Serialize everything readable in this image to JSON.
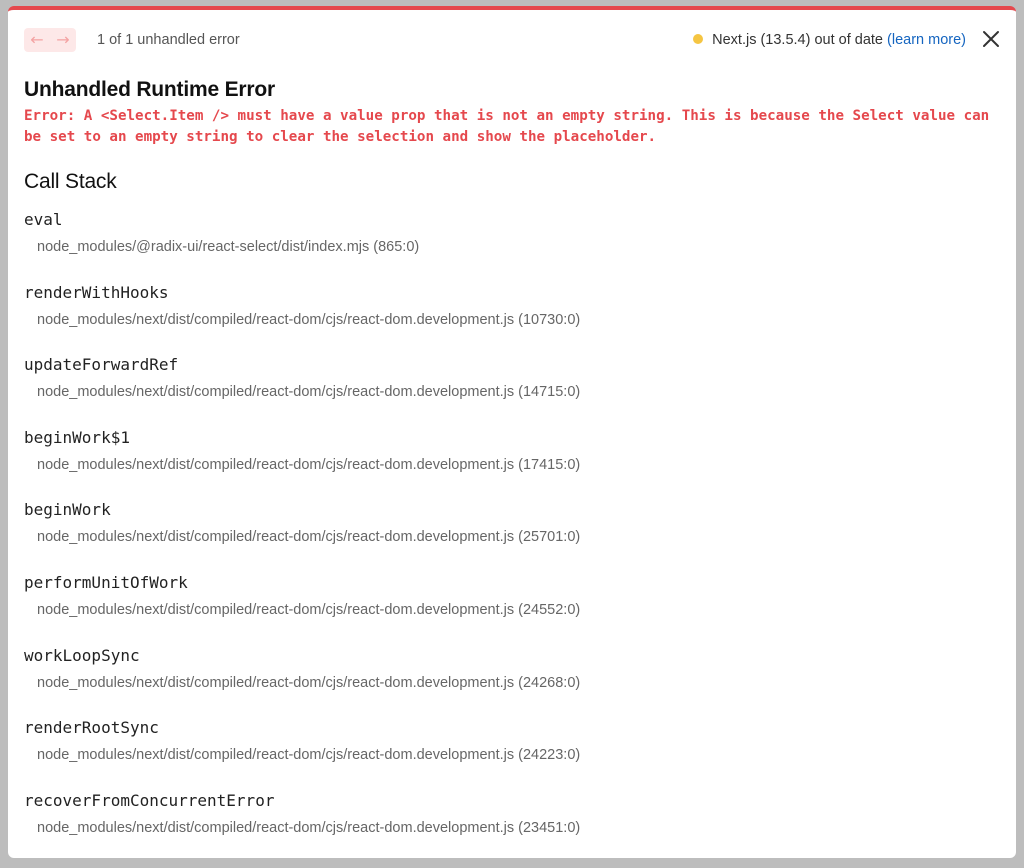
{
  "header": {
    "prev_icon": "arrow-left-icon",
    "next_icon": "arrow-right-icon",
    "error_count": "1 of 1 unhandled error",
    "version_text": "Next.js (13.5.4) out of date",
    "learn_more": "(learn more)",
    "status_color": "#f5c542",
    "close_icon": "close-icon"
  },
  "error": {
    "title": "Unhandled Runtime Error",
    "message": "Error: A <Select.Item /> must have a value prop that is not an empty string. This is because the Select value can be set to an empty string to clear the selection and show the placeholder.",
    "accent_color": "#e5484d"
  },
  "callstack": {
    "title": "Call Stack",
    "frames": [
      {
        "fn": "eval",
        "location": "node_modules/@radix-ui/react-select/dist/index.mjs (865:0)"
      },
      {
        "fn": "renderWithHooks",
        "location": "node_modules/next/dist/compiled/react-dom/cjs/react-dom.development.js (10730:0)"
      },
      {
        "fn": "updateForwardRef",
        "location": "node_modules/next/dist/compiled/react-dom/cjs/react-dom.development.js (14715:0)"
      },
      {
        "fn": "beginWork$1",
        "location": "node_modules/next/dist/compiled/react-dom/cjs/react-dom.development.js (17415:0)"
      },
      {
        "fn": "beginWork",
        "location": "node_modules/next/dist/compiled/react-dom/cjs/react-dom.development.js (25701:0)"
      },
      {
        "fn": "performUnitOfWork",
        "location": "node_modules/next/dist/compiled/react-dom/cjs/react-dom.development.js (24552:0)"
      },
      {
        "fn": "workLoopSync",
        "location": "node_modules/next/dist/compiled/react-dom/cjs/react-dom.development.js (24268:0)"
      },
      {
        "fn": "renderRootSync",
        "location": "node_modules/next/dist/compiled/react-dom/cjs/react-dom.development.js (24223:0)"
      },
      {
        "fn": "recoverFromConcurrentError",
        "location": "node_modules/next/dist/compiled/react-dom/cjs/react-dom.development.js (23451:0)"
      }
    ]
  }
}
